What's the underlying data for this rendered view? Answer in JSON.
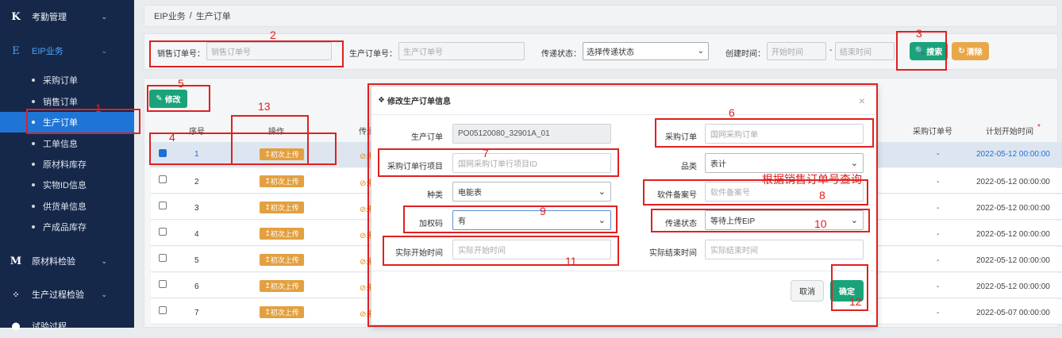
{
  "sidebar": {
    "groups": [
      {
        "icon": "K",
        "label": "考勤管理"
      },
      {
        "icon": "E",
        "label": "EIP业务"
      },
      {
        "icon": "M",
        "label": "原材料检验"
      },
      {
        "icon": "⁘",
        "label": "生产过程检验"
      },
      {
        "icon": "",
        "label": "试验过程"
      }
    ],
    "items": [
      "采购订单",
      "销售订单",
      "生产订单",
      "工单信息",
      "原材料库存",
      "实物ID信息",
      "供货单信息",
      "产成品库存"
    ]
  },
  "breadcrumb": {
    "parent": "EIP业务",
    "sep": "/",
    "current": "生产订单"
  },
  "filters": {
    "sales_order_label": "销售订单号：",
    "sales_order_placeholder": "销售订单号",
    "prod_order_label": "生产订单号：",
    "prod_order_placeholder": "生产订单号",
    "transfer_label": "传递状态：",
    "transfer_value": "选择传递状态",
    "created_label": "创建时间：",
    "start_placeholder": "开始时间",
    "dash": "-",
    "end_placeholder": "结束时间",
    "search_label": "搜索",
    "clear_label": "清除"
  },
  "toolbar": {
    "edit_label": "修改"
  },
  "table": {
    "headers": {
      "seq": "序号",
      "op": "操作",
      "transfer": "传递",
      "purchase": "采购订单号",
      "plan_start": "计划开始时间",
      "required_mark": "*"
    },
    "upload_label": "初次上传",
    "status_text": "未",
    "rows": [
      {
        "seq": "1",
        "purchase": "-",
        "date": "2022-05-12 00:00:00"
      },
      {
        "seq": "2",
        "purchase": "-",
        "date": "2022-05-12 00:00:00"
      },
      {
        "seq": "3",
        "purchase": "-",
        "date": "2022-05-12 00:00:00"
      },
      {
        "seq": "4",
        "purchase": "-",
        "date": "2022-05-12 00:00:00"
      },
      {
        "seq": "5",
        "purchase": "-",
        "date": "2022-05-12 00:00:00"
      },
      {
        "seq": "6",
        "purchase": "-",
        "date": "2022-05-12 00:00:00"
      },
      {
        "seq": "7",
        "purchase": "-",
        "date": "2022-05-07 00:00:00"
      }
    ]
  },
  "modal": {
    "title": "修改生产订单信息",
    "close": "×",
    "prod_order_label": "生产订单",
    "prod_order_value": "PO05120080_32901A_01",
    "purchase_label": "采购订单",
    "purchase_placeholder": "国网采购订单",
    "purchase_item_label": "采购订单行项目",
    "purchase_item_placeholder": "国网采购订单行项目ID",
    "category_label": "品类",
    "category_value": "表计",
    "type_label": "种类",
    "type_value": "电能表",
    "software_label": "软件备案号",
    "software_placeholder": "软件备案号",
    "encrypt_label": "加权码",
    "encrypt_value": "有",
    "transfer_label": "传递状态",
    "transfer_value": "等待上传EIP",
    "actual_start_label": "实际开始时间",
    "actual_start_placeholder": "实际开始时间",
    "actual_end_label": "实际结束时间",
    "actual_end_placeholder": "实际结束时间",
    "cancel_label": "取消",
    "confirm_label": "确定"
  },
  "annotations": {
    "n1": "1",
    "n2": "2",
    "n3": "3",
    "n4": "4",
    "n5": "5",
    "n6": "6",
    "n7": "7",
    "n8": "8",
    "n9": "9",
    "n10": "10",
    "n11": "11",
    "n12": "12",
    "n13": "13",
    "note": "根据销售订单号查询"
  },
  "colors": {
    "sidebar_bg": "#16284a",
    "active": "#1f75d6",
    "success": "#1aa37a",
    "warning": "#e2a042",
    "annotation": "#e02020"
  }
}
